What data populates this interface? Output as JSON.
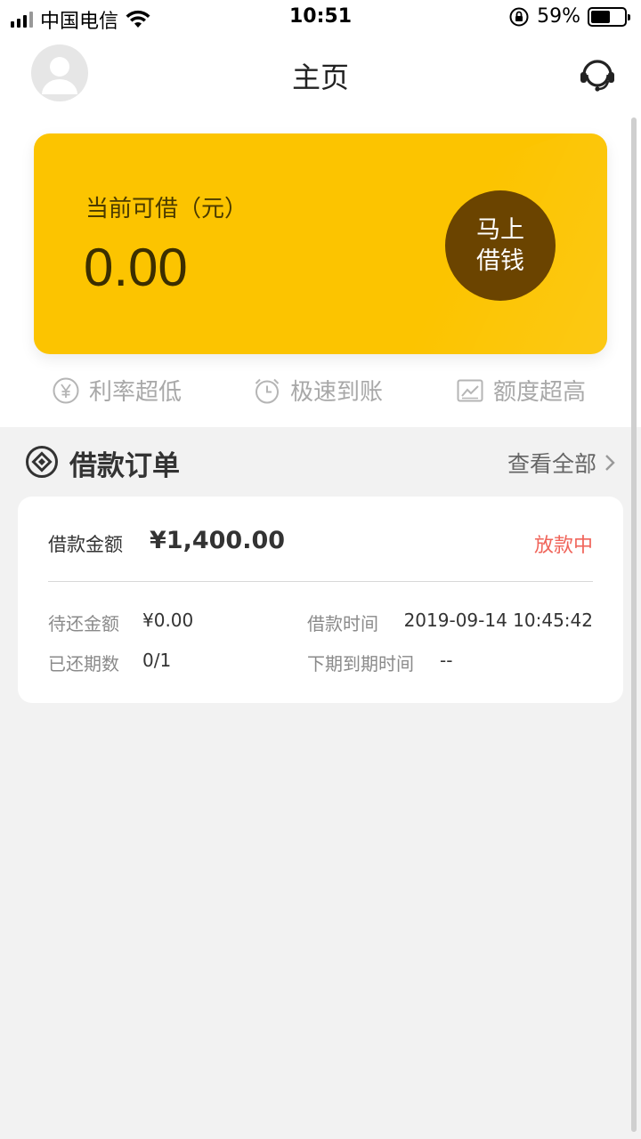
{
  "status_bar": {
    "carrier": "中国电信",
    "time": "10:51",
    "battery_percent": "59%",
    "battery_level": 0.59
  },
  "nav": {
    "title": "主页",
    "avatar_icon": "user-avatar-icon",
    "service_icon": "headset-icon"
  },
  "card": {
    "label": "当前可借（元）",
    "amount": "0.00",
    "button_line1": "马上",
    "button_line2": "借钱",
    "accent_color": "#fcc400",
    "button_color": "#6b4400"
  },
  "features": [
    {
      "icon": "yen-icon",
      "label": "利率超低"
    },
    {
      "icon": "clock-icon",
      "label": "极速到账"
    },
    {
      "icon": "chart-icon",
      "label": "额度超高"
    }
  ],
  "orders": {
    "title": "借款订单",
    "view_all": "查看全部",
    "order": {
      "amount_label": "借款金额",
      "amount": "¥1,400.00",
      "status": "放款中",
      "status_color": "#f0645a",
      "pending_label": "待还金额",
      "pending_value": "¥0.00",
      "borrow_time_label": "借款时间",
      "borrow_time_value": "2019-09-14 10:45:42",
      "periods_label": "已还期数",
      "periods_value": "0/1",
      "next_due_label": "下期到期时间",
      "next_due_value": "--"
    }
  }
}
